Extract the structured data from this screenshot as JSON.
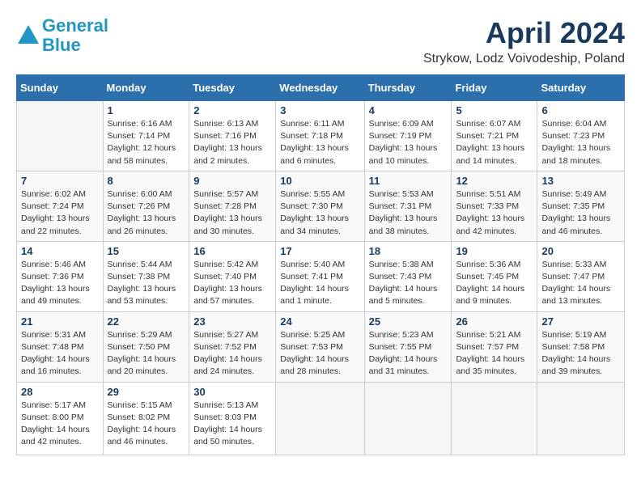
{
  "header": {
    "logo_line1": "General",
    "logo_line2": "Blue",
    "month_year": "April 2024",
    "location": "Strykow, Lodz Voivodeship, Poland"
  },
  "weekdays": [
    "Sunday",
    "Monday",
    "Tuesday",
    "Wednesday",
    "Thursday",
    "Friday",
    "Saturday"
  ],
  "weeks": [
    [
      {
        "day": "",
        "sunrise": "",
        "sunset": "",
        "daylight": ""
      },
      {
        "day": "1",
        "sunrise": "Sunrise: 6:16 AM",
        "sunset": "Sunset: 7:14 PM",
        "daylight": "Daylight: 12 hours and 58 minutes."
      },
      {
        "day": "2",
        "sunrise": "Sunrise: 6:13 AM",
        "sunset": "Sunset: 7:16 PM",
        "daylight": "Daylight: 13 hours and 2 minutes."
      },
      {
        "day": "3",
        "sunrise": "Sunrise: 6:11 AM",
        "sunset": "Sunset: 7:18 PM",
        "daylight": "Daylight: 13 hours and 6 minutes."
      },
      {
        "day": "4",
        "sunrise": "Sunrise: 6:09 AM",
        "sunset": "Sunset: 7:19 PM",
        "daylight": "Daylight: 13 hours and 10 minutes."
      },
      {
        "day": "5",
        "sunrise": "Sunrise: 6:07 AM",
        "sunset": "Sunset: 7:21 PM",
        "daylight": "Daylight: 13 hours and 14 minutes."
      },
      {
        "day": "6",
        "sunrise": "Sunrise: 6:04 AM",
        "sunset": "Sunset: 7:23 PM",
        "daylight": "Daylight: 13 hours and 18 minutes."
      }
    ],
    [
      {
        "day": "7",
        "sunrise": "Sunrise: 6:02 AM",
        "sunset": "Sunset: 7:24 PM",
        "daylight": "Daylight: 13 hours and 22 minutes."
      },
      {
        "day": "8",
        "sunrise": "Sunrise: 6:00 AM",
        "sunset": "Sunset: 7:26 PM",
        "daylight": "Daylight: 13 hours and 26 minutes."
      },
      {
        "day": "9",
        "sunrise": "Sunrise: 5:57 AM",
        "sunset": "Sunset: 7:28 PM",
        "daylight": "Daylight: 13 hours and 30 minutes."
      },
      {
        "day": "10",
        "sunrise": "Sunrise: 5:55 AM",
        "sunset": "Sunset: 7:30 PM",
        "daylight": "Daylight: 13 hours and 34 minutes."
      },
      {
        "day": "11",
        "sunrise": "Sunrise: 5:53 AM",
        "sunset": "Sunset: 7:31 PM",
        "daylight": "Daylight: 13 hours and 38 minutes."
      },
      {
        "day": "12",
        "sunrise": "Sunrise: 5:51 AM",
        "sunset": "Sunset: 7:33 PM",
        "daylight": "Daylight: 13 hours and 42 minutes."
      },
      {
        "day": "13",
        "sunrise": "Sunrise: 5:49 AM",
        "sunset": "Sunset: 7:35 PM",
        "daylight": "Daylight: 13 hours and 46 minutes."
      }
    ],
    [
      {
        "day": "14",
        "sunrise": "Sunrise: 5:46 AM",
        "sunset": "Sunset: 7:36 PM",
        "daylight": "Daylight: 13 hours and 49 minutes."
      },
      {
        "day": "15",
        "sunrise": "Sunrise: 5:44 AM",
        "sunset": "Sunset: 7:38 PM",
        "daylight": "Daylight: 13 hours and 53 minutes."
      },
      {
        "day": "16",
        "sunrise": "Sunrise: 5:42 AM",
        "sunset": "Sunset: 7:40 PM",
        "daylight": "Daylight: 13 hours and 57 minutes."
      },
      {
        "day": "17",
        "sunrise": "Sunrise: 5:40 AM",
        "sunset": "Sunset: 7:41 PM",
        "daylight": "Daylight: 14 hours and 1 minute."
      },
      {
        "day": "18",
        "sunrise": "Sunrise: 5:38 AM",
        "sunset": "Sunset: 7:43 PM",
        "daylight": "Daylight: 14 hours and 5 minutes."
      },
      {
        "day": "19",
        "sunrise": "Sunrise: 5:36 AM",
        "sunset": "Sunset: 7:45 PM",
        "daylight": "Daylight: 14 hours and 9 minutes."
      },
      {
        "day": "20",
        "sunrise": "Sunrise: 5:33 AM",
        "sunset": "Sunset: 7:47 PM",
        "daylight": "Daylight: 14 hours and 13 minutes."
      }
    ],
    [
      {
        "day": "21",
        "sunrise": "Sunrise: 5:31 AM",
        "sunset": "Sunset: 7:48 PM",
        "daylight": "Daylight: 14 hours and 16 minutes."
      },
      {
        "day": "22",
        "sunrise": "Sunrise: 5:29 AM",
        "sunset": "Sunset: 7:50 PM",
        "daylight": "Daylight: 14 hours and 20 minutes."
      },
      {
        "day": "23",
        "sunrise": "Sunrise: 5:27 AM",
        "sunset": "Sunset: 7:52 PM",
        "daylight": "Daylight: 14 hours and 24 minutes."
      },
      {
        "day": "24",
        "sunrise": "Sunrise: 5:25 AM",
        "sunset": "Sunset: 7:53 PM",
        "daylight": "Daylight: 14 hours and 28 minutes."
      },
      {
        "day": "25",
        "sunrise": "Sunrise: 5:23 AM",
        "sunset": "Sunset: 7:55 PM",
        "daylight": "Daylight: 14 hours and 31 minutes."
      },
      {
        "day": "26",
        "sunrise": "Sunrise: 5:21 AM",
        "sunset": "Sunset: 7:57 PM",
        "daylight": "Daylight: 14 hours and 35 minutes."
      },
      {
        "day": "27",
        "sunrise": "Sunrise: 5:19 AM",
        "sunset": "Sunset: 7:58 PM",
        "daylight": "Daylight: 14 hours and 39 minutes."
      }
    ],
    [
      {
        "day": "28",
        "sunrise": "Sunrise: 5:17 AM",
        "sunset": "Sunset: 8:00 PM",
        "daylight": "Daylight: 14 hours and 42 minutes."
      },
      {
        "day": "29",
        "sunrise": "Sunrise: 5:15 AM",
        "sunset": "Sunset: 8:02 PM",
        "daylight": "Daylight: 14 hours and 46 minutes."
      },
      {
        "day": "30",
        "sunrise": "Sunrise: 5:13 AM",
        "sunset": "Sunset: 8:03 PM",
        "daylight": "Daylight: 14 hours and 50 minutes."
      },
      {
        "day": "",
        "sunrise": "",
        "sunset": "",
        "daylight": ""
      },
      {
        "day": "",
        "sunrise": "",
        "sunset": "",
        "daylight": ""
      },
      {
        "day": "",
        "sunrise": "",
        "sunset": "",
        "daylight": ""
      },
      {
        "day": "",
        "sunrise": "",
        "sunset": "",
        "daylight": ""
      }
    ]
  ]
}
